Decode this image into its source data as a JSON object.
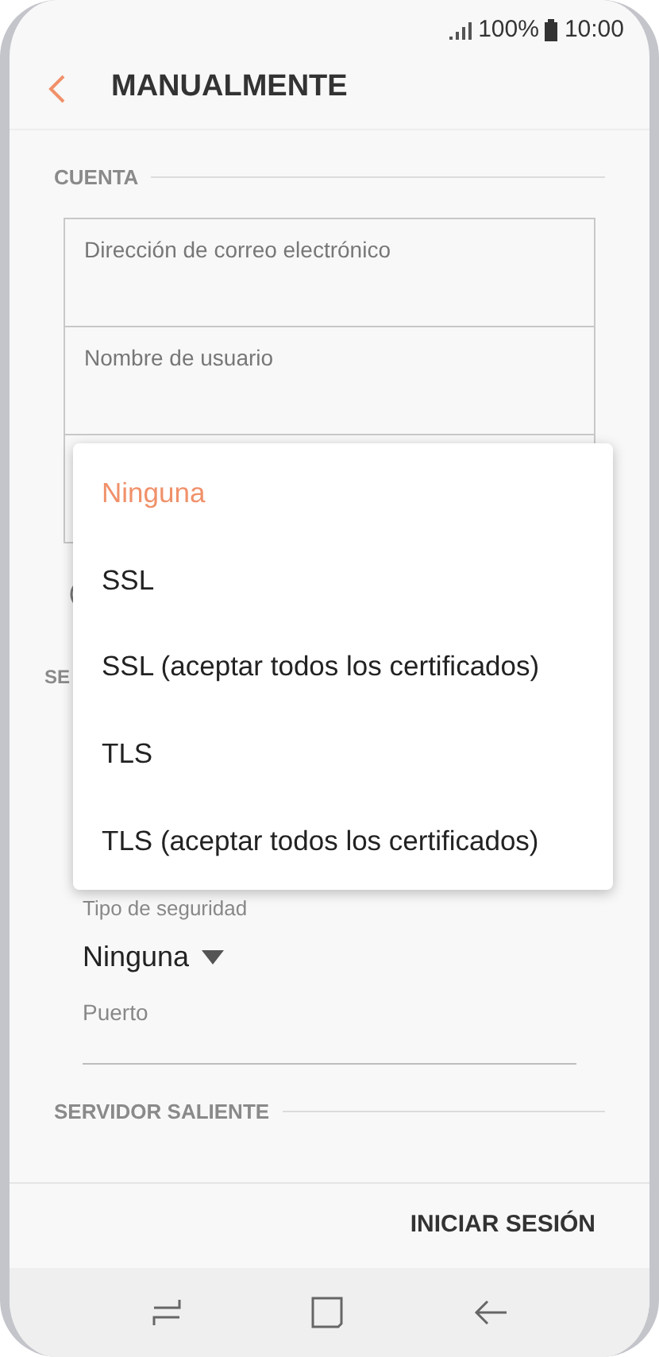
{
  "status_bar": {
    "battery": "100%",
    "time": "10:00"
  },
  "header": {
    "title": "MANUALMENTE"
  },
  "account": {
    "heading": "CUENTA",
    "fields": [
      {
        "placeholder": "Dirección de correo electrónico"
      },
      {
        "placeholder": "Nombre de usuario"
      }
    ]
  },
  "incoming": {
    "heading": "SE",
    "security_label": "Tipo de seguridad",
    "security_value": "Ninguna",
    "port": {
      "placeholder": "Puerto"
    }
  },
  "outgoing": {
    "heading": "SERVIDOR SALIENTE"
  },
  "action": "INICIAR SESIÓN",
  "menu": {
    "options": [
      {
        "label": "Ninguna",
        "selected": true
      },
      {
        "label": "SSL",
        "selected": false
      },
      {
        "label": "SSL (aceptar todos los certificados)",
        "selected": false
      },
      {
        "label": "TLS",
        "selected": false
      },
      {
        "label": "TLS (aceptar todos los certificados)",
        "selected": false
      }
    ]
  }
}
